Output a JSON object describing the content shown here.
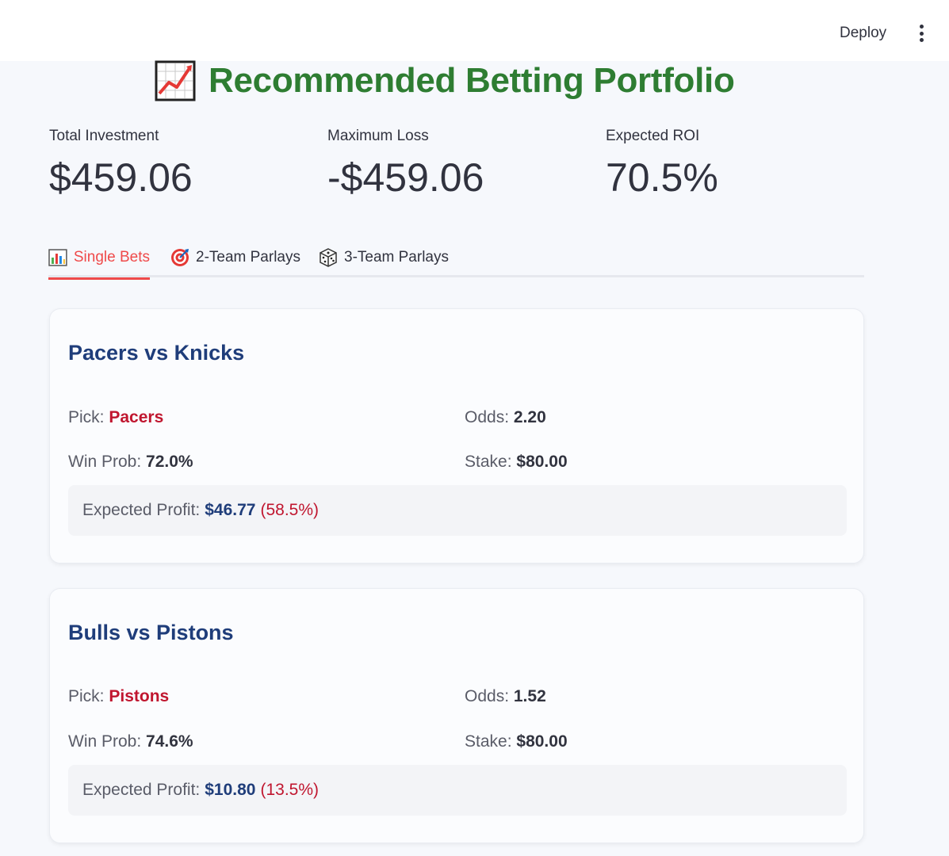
{
  "header": {
    "deploy_label": "Deploy"
  },
  "page": {
    "title": "Recommended Betting Portfolio"
  },
  "metrics": [
    {
      "label": "Total Investment",
      "value": "$459.06"
    },
    {
      "label": "Maximum Loss",
      "value": "-$459.06"
    },
    {
      "label": "Expected ROI",
      "value": "70.5%"
    }
  ],
  "tabs": [
    {
      "label": "Single Bets",
      "icon": "bar-chart-icon",
      "active": true
    },
    {
      "label": "2-Team Parlays",
      "icon": "target-icon",
      "active": false
    },
    {
      "label": "3-Team Parlays",
      "icon": "dice-icon",
      "active": false
    }
  ],
  "labels": {
    "pick": "Pick:",
    "odds": "Odds:",
    "win_prob": "Win Prob:",
    "stake": "Stake:",
    "expected_profit": "Expected Profit:"
  },
  "bets": [
    {
      "matchup": "Pacers vs Knicks",
      "pick": "Pacers",
      "odds": "2.20",
      "win_prob": "72.0%",
      "stake": "$80.00",
      "expected_profit": "$46.77",
      "expected_profit_pct": "(58.5%)"
    },
    {
      "matchup": "Bulls vs Pistons",
      "pick": "Pistons",
      "odds": "1.52",
      "win_prob": "74.6%",
      "stake": "$80.00",
      "expected_profit": "$10.80",
      "expected_profit_pct": "(13.5%)"
    }
  ],
  "colors": {
    "title_green": "#2e7d32",
    "active_tab_red": "#ef4a4a",
    "card_title_blue": "#1f3d7a",
    "pick_red": "#c0162f"
  }
}
